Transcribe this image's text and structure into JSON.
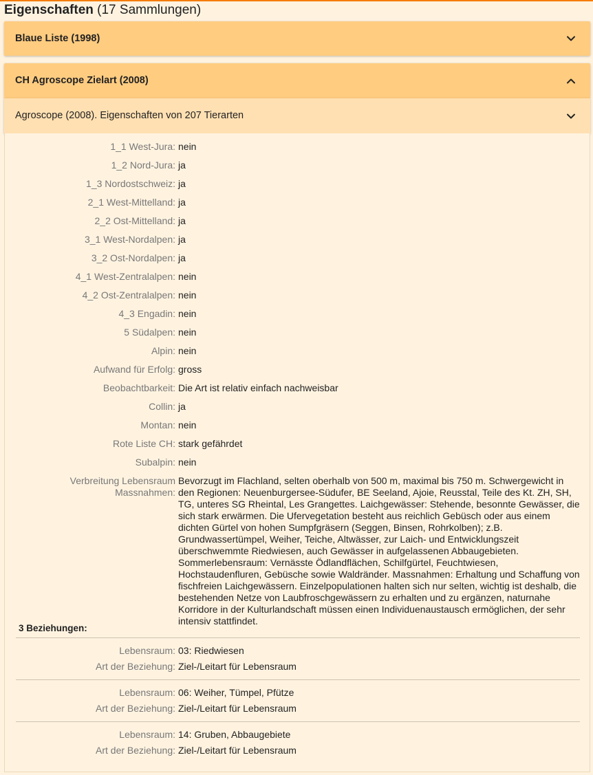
{
  "header": {
    "title": "Eigenschaften",
    "subtitle": "(17 Sammlungen)"
  },
  "collections": [
    {
      "title": "Blaue Liste (1998)",
      "expanded": false
    },
    {
      "title": "CH Agroscope Zielart (2008)",
      "expanded": true,
      "description": "Agroscope (2008). Eigenschaften von 207 Tierarten"
    }
  ],
  "properties": [
    {
      "label": "1_1 West-Jura:",
      "value": "nein"
    },
    {
      "label": "1_2 Nord-Jura:",
      "value": "ja"
    },
    {
      "label": "1_3 Nordostschweiz:",
      "value": "ja"
    },
    {
      "label": "2_1 West-Mittelland:",
      "value": "ja"
    },
    {
      "label": "2_2 Ost-Mittelland:",
      "value": "ja"
    },
    {
      "label": "3_1 West-Nordalpen:",
      "value": "ja"
    },
    {
      "label": "3_2 Ost-Nordalpen:",
      "value": "ja"
    },
    {
      "label": "4_1 West-Zentralalpen:",
      "value": "nein"
    },
    {
      "label": "4_2 Ost-Zentralalpen:",
      "value": "nein"
    },
    {
      "label": "4_3 Engadin:",
      "value": "nein"
    },
    {
      "label": "5 Südalpen:",
      "value": "nein"
    },
    {
      "label": "Alpin:",
      "value": "nein"
    },
    {
      "label": "Aufwand für Erfolg:",
      "value": "gross"
    },
    {
      "label": "Beobachtbarkeit:",
      "value": "Die Art ist relativ einfach nachweisbar"
    },
    {
      "label": "Collin:",
      "value": "ja"
    },
    {
      "label": "Montan:",
      "value": "nein"
    },
    {
      "label": "Rote Liste CH:",
      "value": "stark gefährdet"
    },
    {
      "label": "Subalpin:",
      "value": "nein"
    }
  ],
  "long_property": {
    "label": "Verbreitung Lebensraum Massnahmen:",
    "value": "Bevorzugt im Flachland, selten oberhalb von 500 m, maximal bis 750 m. Schwergewicht in den Regionen: Neuenburgersee-Südufer, BE Seeland, Ajoie, Reusstal, Teile des Kt. ZH, SH, TG, unteres SG Rheintal, Les Grangettes. Laichgewässer: Stehende, besonnte Gewässer, die sich stark erwärmen. Die Ufervegetation besteht aus reichlich Gebüsch oder aus einem dichten Gürtel von hohen Sumpfgräsern (Seggen, Binsen, Rohrkolben); z.B. Grundwassertümpel, Weiher, Teiche, Altwässer, zur Laich- und Entwicklungszeit überschwemmte Riedwiesen, auch Gewässer in aufgelassenen Abbaugebieten. Sommerlebensraum: Vernässte Ödlandflächen, Schilfgürtel, Feuchtwiesen, Hochstaudenfluren, Gebüsche sowie Waldränder. Massnahmen: Erhaltung und Schaffung von fischfreien Laichgewässern. Einzelpopulationen halten sich nur selten, wichtig ist deshalb, die bestehenden Netze von Laubfroschgewässern zu erhalten und zu ergänzen, naturnahe Korridore in der Kulturlandschaft müssen einen Individuenaustausch ermöglichen, der sehr intensiv stattfindet."
  },
  "relations": {
    "header": "3 Beziehungen:",
    "items": [
      {
        "lebensraum_label": "Lebensraum:",
        "lebensraum": "03: Riedwiesen",
        "art_label": "Art der Beziehung:",
        "art": "Ziel-/Leitart für Lebensraum"
      },
      {
        "lebensraum_label": "Lebensraum:",
        "lebensraum": "06: Weiher, Tümpel, Pfütze",
        "art_label": "Art der Beziehung:",
        "art": "Ziel-/Leitart für Lebensraum"
      },
      {
        "lebensraum_label": "Lebensraum:",
        "lebensraum": "14: Gruben, Abbaugebiete",
        "art_label": "Art der Beziehung:",
        "art": "Ziel-/Leitart für Lebensraum"
      }
    ]
  },
  "colors": {
    "accent": "#f57c00",
    "panel": "#ffcc80",
    "subpanel": "#ffe0b2",
    "background": "#fff3e0"
  },
  "icons": {
    "collapsed": "chevron-down-icon",
    "expanded": "chevron-up-icon"
  }
}
